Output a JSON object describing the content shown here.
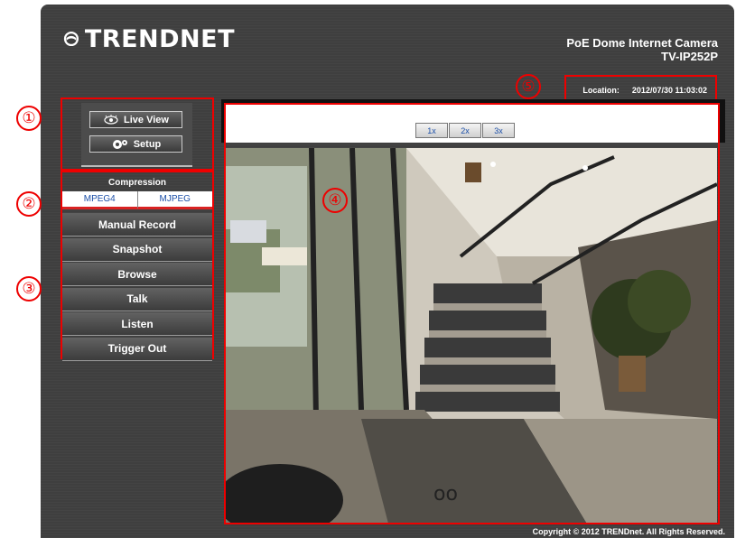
{
  "brand": {
    "name": "TRENDnet",
    "logo_text": "TRENDNET"
  },
  "header": {
    "product_title": "PoE Dome Internet Camera",
    "model": "TV-IP252P"
  },
  "nav": {
    "live_view_label": "Live View",
    "setup_label": "Setup"
  },
  "compression": {
    "title": "Compression",
    "options": [
      "MPEG4",
      "MJPEG"
    ]
  },
  "menu": {
    "items": [
      "Manual Record",
      "Snapshot",
      "Browse",
      "Talk",
      "Listen",
      "Trigger Out"
    ]
  },
  "status": {
    "location_label": "Location:",
    "timestamp": "2012/07/30 11:03:02"
  },
  "zoom": {
    "buttons": [
      "1x",
      "2x",
      "3x"
    ]
  },
  "footer": {
    "copyright": "Copyright © 2012 TRENDnet. All Rights Reserved."
  },
  "annotations": [
    "①",
    "②",
    "③",
    "④",
    "⑤"
  ],
  "colors": {
    "frame": "#3f3f3f",
    "annotation_red": "#e00000",
    "link_blue": "#1b4fa8"
  },
  "icons": {
    "brand": "trendnet-logo-icon",
    "live_view": "eye-icon",
    "setup": "gears-icon"
  }
}
